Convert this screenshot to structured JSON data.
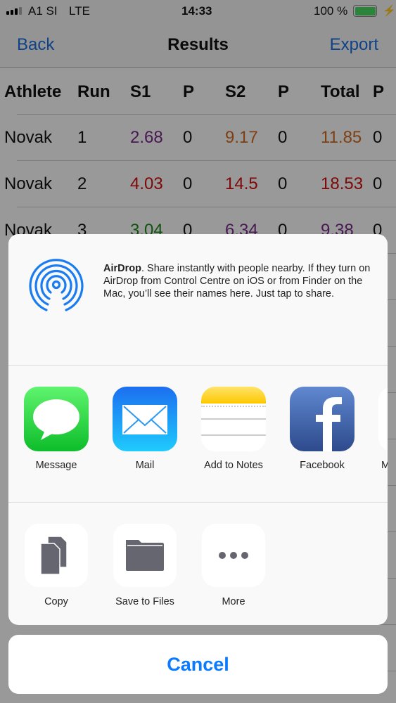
{
  "status_bar": {
    "carrier": "A1 SI",
    "network": "LTE",
    "time": "14:33",
    "battery": "100 %",
    "battery_level": 100
  },
  "nav": {
    "back": "Back",
    "title": "Results",
    "export": "Export"
  },
  "table": {
    "headers": [
      "Athlete",
      "Run",
      "S1",
      "P",
      "S2",
      "P",
      "Total",
      "P"
    ],
    "rows": [
      {
        "athlete": "Novak",
        "run": "1",
        "s1": "2.68",
        "p1": "0",
        "s2": "9.17",
        "p2": "0",
        "total": "11.85",
        "pt": "0",
        "colors": {
          "s1": "#7a2a8c",
          "s2": "#d2691e",
          "total": "#d2691e"
        }
      },
      {
        "athlete": "Novak",
        "run": "2",
        "s1": "4.03",
        "p1": "0",
        "s2": "14.5",
        "p2": "0",
        "total": "18.53",
        "pt": "0",
        "colors": {
          "s1": "#d01010",
          "s2": "#d01010",
          "total": "#d01010"
        }
      },
      {
        "athlete": "Novak",
        "run": "3",
        "s1": "3.04",
        "p1": "0",
        "s2": "6.34",
        "p2": "0",
        "total": "9.38",
        "pt": "0",
        "colors": {
          "s1": "#1a8a1a",
          "s2": "#7a2a8c",
          "total": "#7a2a8c"
        }
      }
    ]
  },
  "share_sheet": {
    "airdrop": {
      "title": "AirDrop",
      "text": ". Share instantly with people nearby. If they turn on AirDrop from Control Centre on iOS or from Finder on the Mac, you’ll see their names here. Just tap to share."
    },
    "apps": [
      {
        "label": "Message",
        "icon": "message-icon"
      },
      {
        "label": "Mail",
        "icon": "mail-icon"
      },
      {
        "label": "Add to Notes",
        "icon": "notes-icon"
      },
      {
        "label": "Facebook",
        "icon": "facebook-icon"
      },
      {
        "label": "M",
        "icon": "partial-app-icon"
      }
    ],
    "actions": [
      {
        "label": "Copy",
        "icon": "copy-icon"
      },
      {
        "label": "Save to Files",
        "icon": "folder-icon"
      },
      {
        "label": "More",
        "icon": "more-icon"
      }
    ],
    "cancel": "Cancel"
  }
}
